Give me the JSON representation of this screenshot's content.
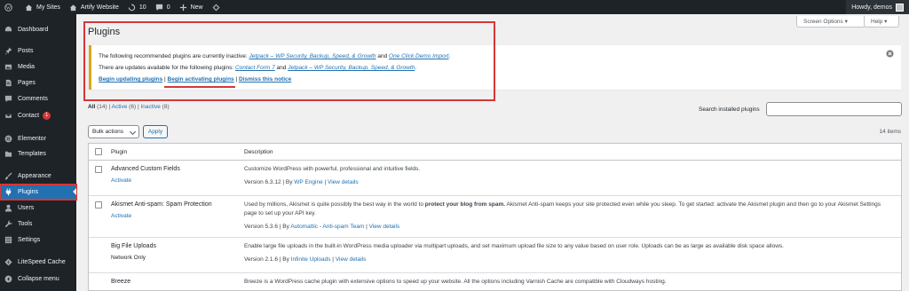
{
  "adminbar": {
    "my_sites": "My Sites",
    "site_name": "Artify Website",
    "updates_count": "10",
    "comments_count": "0",
    "new_label": "New",
    "howdy": "Howdy, demos"
  },
  "sidebar": {
    "items": [
      {
        "label": "Dashboard",
        "icon": "dashboard-icon"
      },
      {
        "label": "Posts",
        "icon": "pin-icon"
      },
      {
        "label": "Media",
        "icon": "media-icon"
      },
      {
        "label": "Pages",
        "icon": "page-icon"
      },
      {
        "label": "Comments",
        "icon": "comment-icon"
      },
      {
        "label": "Contact",
        "icon": "mail-icon",
        "badge": "1"
      },
      {
        "label": "Elementor",
        "icon": "elementor-icon"
      },
      {
        "label": "Templates",
        "icon": "folder-icon"
      },
      {
        "label": "Appearance",
        "icon": "brush-icon"
      },
      {
        "label": "Plugins",
        "icon": "plugin-icon"
      },
      {
        "label": "Users",
        "icon": "user-icon"
      },
      {
        "label": "Tools",
        "icon": "wrench-icon"
      },
      {
        "label": "Settings",
        "icon": "settings-icon"
      },
      {
        "label": "LiteSpeed Cache",
        "icon": "litespeed-icon"
      },
      {
        "label": "Collapse menu",
        "icon": "collapse-icon"
      }
    ]
  },
  "screen_options": "Screen Options ▾",
  "help": "Help ▾",
  "page_title": "Plugins",
  "notice": {
    "line1_prefix": "The following recommended plugins are currently inactive:",
    "line1_link1": "Jetpack – WP Security, Backup, Speed, & Growth",
    "line1_and": "and",
    "line1_link2": "One Click Demo Import",
    "line1_suffix": ".",
    "line2_prefix": "There are updates available for the following plugins:",
    "line2_link1": "Contact Form 7",
    "line2_and": "and",
    "line2_link2": "Jetpack – WP Security, Backup, Speed, & Growth",
    "line2_suffix": ".",
    "begin_updating": "Begin updating plugins",
    "begin_activating": "Begin activating plugins",
    "dismiss": "Dismiss this notice",
    "sep": "|"
  },
  "filters": {
    "all": "All",
    "all_count": "(14)",
    "active": "Active",
    "active_count": "(6)",
    "inactive": "Inactive",
    "inactive_count": "(8)",
    "sep": "|"
  },
  "search_label": "Search installed plugins",
  "bulk_actions": "Bulk actions",
  "apply": "Apply",
  "items_count": "14 items",
  "table": {
    "col_plugin": "Plugin",
    "col_description": "Description",
    "rows": [
      {
        "name": "Advanced Custom Fields",
        "action": "Activate",
        "desc": "Customize WordPress with powerful, professional and intuitive fields.",
        "version": "Version 6.3.12",
        "by": "| By",
        "author": "WP Engine",
        "sep": "|",
        "details": "View details"
      },
      {
        "name": "Akismet Anti-spam: Spam Protection",
        "action": "Activate",
        "desc_pre": "Used by millions, Akismet is quite possibly the best way in the world to",
        "desc_bold": "protect your blog from spam.",
        "desc_post": "Akismet Anti-spam keeps your site protected even while you sleep. To get started: activate the Akismet plugin and then go to your Akismet Settings page to set up your API key.",
        "version": "Version 5.3.6",
        "by": "| By",
        "author": "Automattic - Anti-spam Team",
        "sep": "|",
        "details": "View details"
      },
      {
        "name": "Big File Uploads",
        "action": "Network Only",
        "desc": "Enable large file uploads in the built-in WordPress media uploader via multipart uploads, and set maximum upload file size to any value based on user role. Uploads can be as large as available disk space allows.",
        "version": "Version 2.1.6",
        "by": "| By",
        "author": "Infinite Uploads",
        "sep": "|",
        "details": "View details"
      },
      {
        "name": "Breeze",
        "desc": "Breeze is a WordPress cache plugin with extensive options to speed up your website. All the options including Varnish Cache are compatible with Cloudways hosting."
      }
    ]
  }
}
